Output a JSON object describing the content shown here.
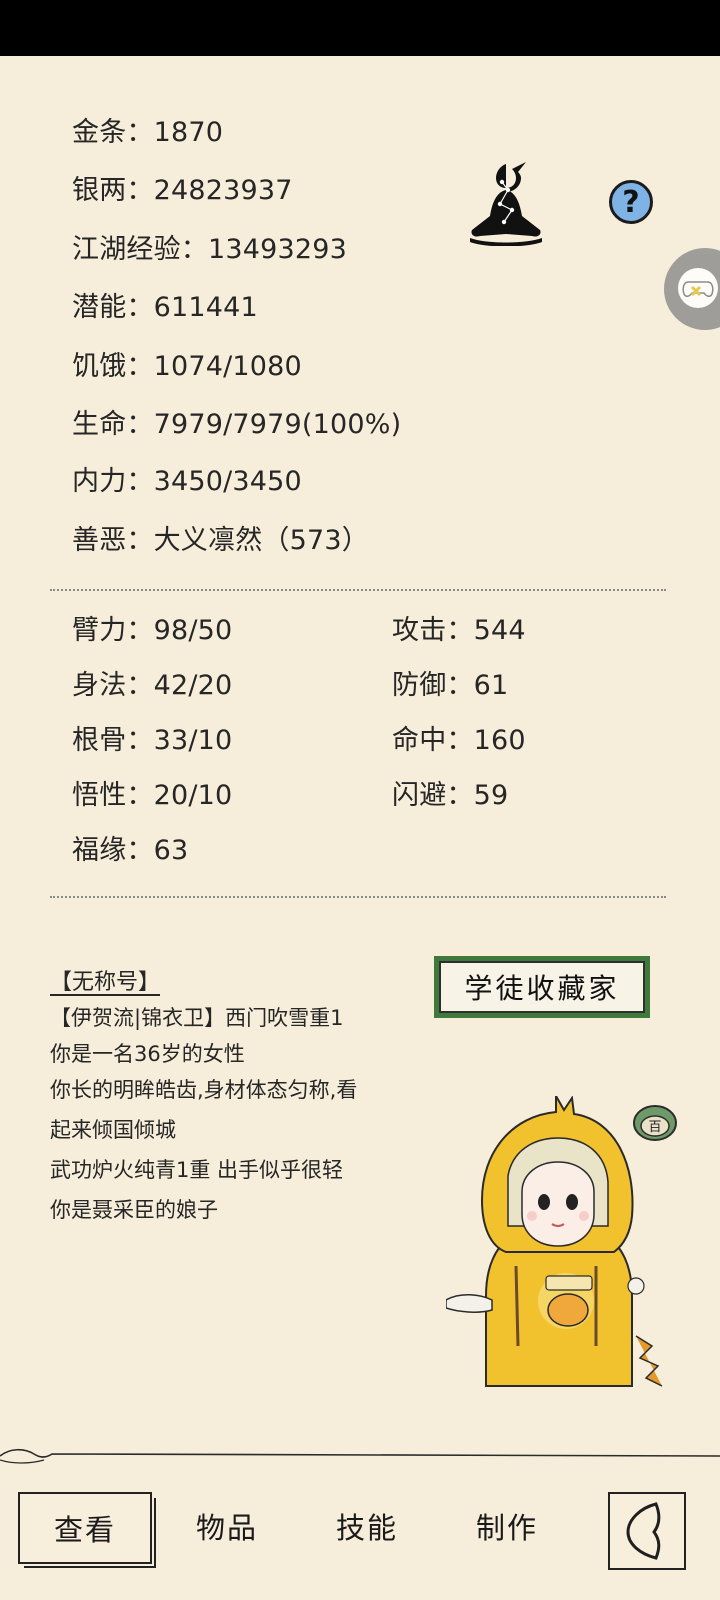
{
  "stats": {
    "gold": "金条：1870",
    "silver": "银两：24823937",
    "exp": "江湖经验：13493293",
    "potential": "潜能：611441",
    "hunger": "饥饿：1074/1080",
    "life": "生命：7979/7979(100%)",
    "inner": "内力：3450/3450",
    "morality": "善恶：大义凛然（573）"
  },
  "attributes": {
    "left": [
      "臂力：98/50",
      "身法：42/20",
      "根骨：33/10",
      "悟性：20/10",
      "福缘：63"
    ],
    "right": [
      "攻击：544",
      "防御：61",
      "命中：160",
      "闪避：59"
    ]
  },
  "help": {
    "label": "?"
  },
  "profile": {
    "title": "【无称号】",
    "lines": [
      "【伊贺流|锦衣卫】西门吹雪重1",
      "你是一名36岁的女性",
      "你长的明眸皓齿,身材体态匀称,看",
      "起来倾国倾城",
      "武功炉火纯青1重 出手似乎很轻",
      "你是聂采臣的娘子"
    ],
    "seal_text": "学徒收藏家",
    "coin_text": "百"
  },
  "nav": {
    "tabs": [
      "查看",
      "物品",
      "技能",
      "制作"
    ],
    "active_index": 0
  },
  "colors": {
    "background": "#f6eedb",
    "seal_green": "#3f7a3c",
    "help_blue": "#7fb3e6",
    "character_yellow": "#f2c12e"
  }
}
